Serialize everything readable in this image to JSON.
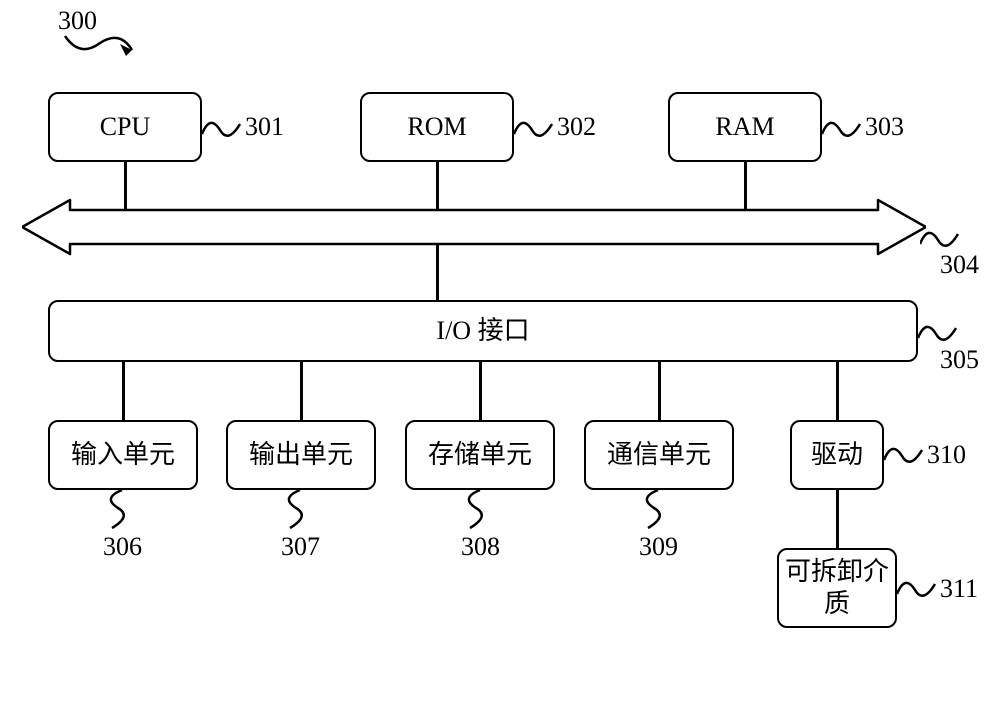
{
  "figureRef": "300",
  "blocks": {
    "cpu": "CPU",
    "rom": "ROM",
    "ram": "RAM",
    "io": "I/O 接口",
    "input": "输入单元",
    "output": "输出单元",
    "storage": "存储单元",
    "comm": "通信单元",
    "drive": "驱动",
    "removable": "可拆卸介质"
  },
  "refs": {
    "cpu": "301",
    "rom": "302",
    "ram": "303",
    "bus": "304",
    "io": "305",
    "input": "306",
    "output": "307",
    "storage": "308",
    "comm": "309",
    "drive": "310",
    "removable": "311"
  }
}
